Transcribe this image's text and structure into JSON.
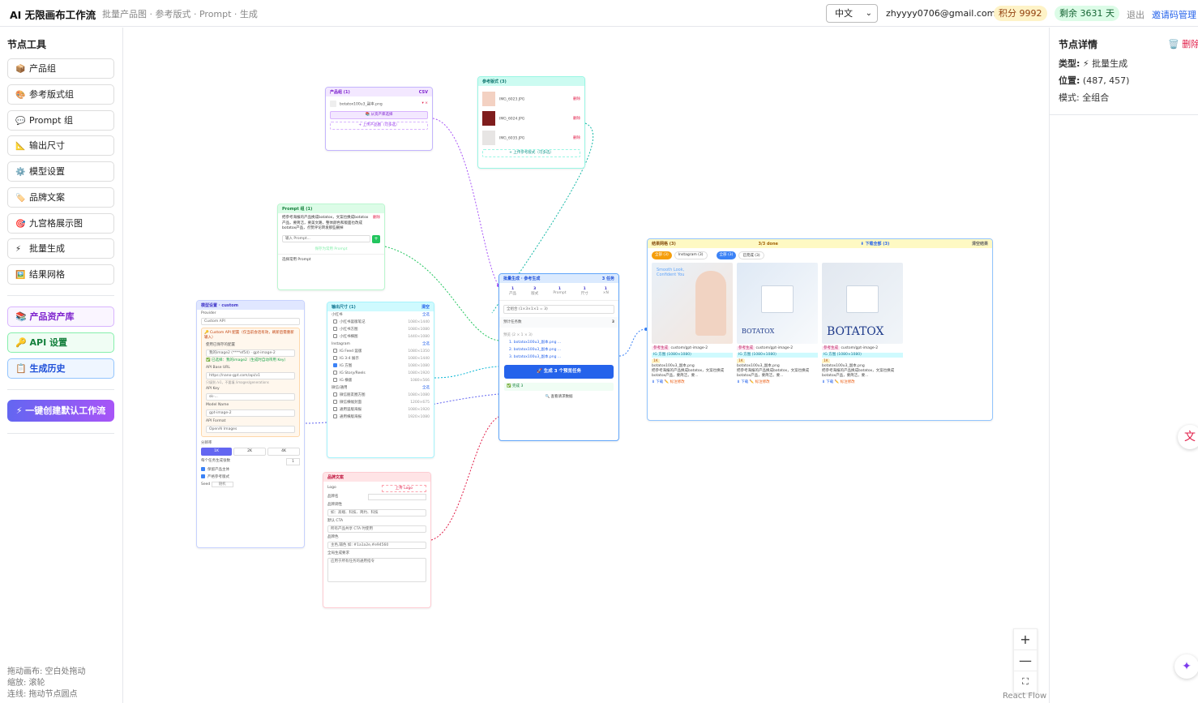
{
  "header": {
    "title": "AI 无限画布工作流",
    "subtitle": "批量产品图 · 参考版式 · Prompt · 生成",
    "language": "中文",
    "email": "zhyyyy0706@gmail.com",
    "points": "积分 9992",
    "days_left": "剩余 3631 天",
    "logout": "退出",
    "invite": "邀请码管理"
  },
  "sidebar": {
    "title": "节点工具",
    "tools": [
      {
        "icon": "📦",
        "label": "产品组"
      },
      {
        "icon": "🎨",
        "label": "参考版式组"
      },
      {
        "icon": "💬",
        "label": "Prompt 组"
      },
      {
        "icon": "📐",
        "label": "输出尺寸"
      },
      {
        "icon": "⚙️",
        "label": "模型设置"
      },
      {
        "icon": "🏷️",
        "label": "品牌文案"
      },
      {
        "icon": "🎯",
        "label": "九宫格展示图"
      },
      {
        "icon": "⚡",
        "label": "批量生成"
      },
      {
        "icon": "🖼️",
        "label": "结果网格"
      }
    ],
    "assets": "📚 产品资产库",
    "api": "🔑 API 设置",
    "history": "📋 生成历史",
    "create_workflow": "⚡ 一键创建默认工作流",
    "hints": [
      "拖动画布: 空白处拖动",
      "缩放: 滚轮",
      "连线: 拖动节点圆点"
    ]
  },
  "nodes": {
    "product": {
      "title": "产品组 (1)",
      "tag": "CSV",
      "file": "botatox100u3_副本.png",
      "pick": "📚 从资产库选择",
      "upload": "+ 上传产品图（可多选）"
    },
    "reference": {
      "title": "参考版式 (3)",
      "items": [
        "IMG_6023.JPG",
        "IMG_6024.JPG",
        "IMG_6035.JPG"
      ],
      "del": "删除",
      "upload": "+ 上传参考版式（可多选）"
    },
    "prompt": {
      "title": "Prompt 组 (1)",
      "text": "把参考海报的产品换成batatox，文案也换成botatox产品，要简洁，要美文路，整体颜色和版面也改成botatox产品，点赞评论转发那些删掉",
      "del": "删除",
      "input": "输入 Prompt...",
      "save": "保存为常用 Prompt",
      "common": "选择常用 Prompt"
    },
    "model": {
      "title": "模型设置 · custom",
      "provider_label": "Provider",
      "provider": "Custom API",
      "warn": "🔑 Custom API 配置（仅当前会话有效，刷新后需重新输入）",
      "saved_label": "使用已保存的配置",
      "saved": "我的image2 (****ef54) · gpt-image-2",
      "selected": "✅ 已选择：我的image2（生成时自动带用 Key）",
      "base_label": "API Base URL",
      "base": "https://nano-gpt.com/api/v1",
      "base_hint": "只填到 /v1，不要填 /images/generations",
      "key_label": "API Key",
      "key": "sk-...",
      "model_label": "Model Name",
      "model": "gpt-image-2",
      "format_label": "API Format",
      "format": "OpenAI Images",
      "res_label": "分辨率",
      "res": [
        "1K",
        "2K",
        "4K"
      ],
      "count_label": "每个任务生成张数",
      "count": "1",
      "keep": "保留产品主体",
      "strict": "严格参考版式",
      "seed_label": "Seed",
      "seed": "随机"
    },
    "size": {
      "title": "输出尺寸 (1)",
      "clear": "清空",
      "groups": [
        {
          "name": "小红书",
          "all": "全选",
          "items": [
            [
              "小红书竖版笔记",
              "1080×1440",
              false
            ],
            [
              "小红书方图",
              "1080×1080",
              false
            ],
            [
              "小红书横图",
              "1440×1080",
              false
            ]
          ]
        },
        {
          "name": "Instagram",
          "all": "全选",
          "items": [
            [
              "IG Feed 竖版",
              "1080×1350",
              false
            ],
            [
              "IG 3:4 展示",
              "1080×1440",
              false
            ],
            [
              "IG 方图",
              "1080×1080",
              true
            ],
            [
              "IG Story/Reels",
              "1080×1920",
              false
            ],
            [
              "IG 横版",
              "1080×566",
              false
            ]
          ]
        },
        {
          "name": "微信/通用",
          "all": "全选",
          "items": [
            [
              "微信朋友圈方图",
              "1080×1080",
              false
            ],
            [
              "微信横幅封面",
              "1200×675",
              false
            ],
            [
              "通用竖版海报",
              "1080×1920",
              false
            ],
            [
              "通用横版海报",
              "1920×1080",
              false
            ]
          ]
        }
      ]
    },
    "brand": {
      "title": "品牌文案",
      "logo_label": "Logo",
      "logo_upload": "上传 Logo",
      "name_label": "品牌名",
      "tone_label": "品牌调性",
      "tone_ph": "如：高端、科技、简约、科技",
      "cta_label": "默认 CTA",
      "cta_ph": "所有产品共享 CTA 时使用",
      "color_label": "品牌色",
      "color_ph": "主色,辅色 如: #1a1a2e,#e94560",
      "global_label": "全局生成要求",
      "global_ph": "应用于所有任务的通用指令"
    },
    "batch": {
      "title": "批量生成 · 参考生成",
      "count": "3 任务",
      "stats": [
        [
          "1",
          "产品"
        ],
        [
          "3",
          "版式"
        ],
        [
          "1",
          "Prompt"
        ],
        [
          "1",
          "尺寸"
        ],
        [
          "1",
          "×N"
        ]
      ],
      "mode": "全组合 (1×3×1×1 = 3)",
      "est_label": "预计任务数",
      "est": "3",
      "preview_label": "预览 (2 × 1 × 3)",
      "preview": [
        "1. botatox100u3_副本.png ...",
        "2. botatox100u3_副本.png ...",
        "3. botatox100u3_副本.png ..."
      ],
      "go": "🚀 生成 3 个预览任务",
      "done": "✅ 完成 3",
      "view": "🔍 查看请求数据"
    },
    "results": {
      "title": "结果网格 (3)",
      "status": "3/3 done",
      "download": "⬇ 下载全部 (3)",
      "clear": "清空结果",
      "filters": [
        "全部 (3)",
        "Instagram (3)"
      ],
      "filters2": [
        "全部 (3)",
        "已完成 (3)"
      ],
      "cards": [
        {
          "tag": "参考生成",
          "model": "custom/gpt-image-2",
          "size": "IG 方图 (1080×1080)",
          "res": "1K",
          "file": "botatox100u3_副本.png",
          "desc": "把参考海报的产品换成batatox，文案也换成botatox产品，要简洁，要...",
          "dl": "⬇ 下载",
          "mark": "✏️ 标注修改"
        },
        {
          "tag": "参考生成",
          "model": "custom/gpt-image-2",
          "size": "IG 方图 (1080×1080)",
          "res": "1K",
          "file": "botatox100u3_副本.png",
          "desc": "把参考海报的产品换成batatox，文案也换成botatox产品，要简洁，要...",
          "dl": "⬇ 下载",
          "mark": "✏️ 标注修改"
        },
        {
          "tag": "参考生成",
          "model": "custom/gpt-image-2",
          "size": "IG 方图 (1080×1080)",
          "res": "1K",
          "file": "botatox100u3_副本.png",
          "desc": "把参考海报的产品换成batatox，文案也换成botatox产品，要简洁，要...",
          "dl": "⬇ 下载",
          "mark": "✏️ 标注修改"
        }
      ],
      "img_texts": [
        "Smooth Look, Confident You",
        "BOTATOX",
        "BOTATOX"
      ]
    }
  },
  "controls": {
    "zoom_in": "+",
    "zoom_out": "—",
    "fit": "⛶",
    "attribution": "React Flow"
  },
  "details": {
    "title": "节点详情",
    "delete": "🗑️ 删除",
    "type_label": "类型:",
    "type": "⚡ 批量生成",
    "pos_label": "位置:",
    "pos": "(487, 457)",
    "mode_label": "模式:",
    "mode": "全组合"
  }
}
